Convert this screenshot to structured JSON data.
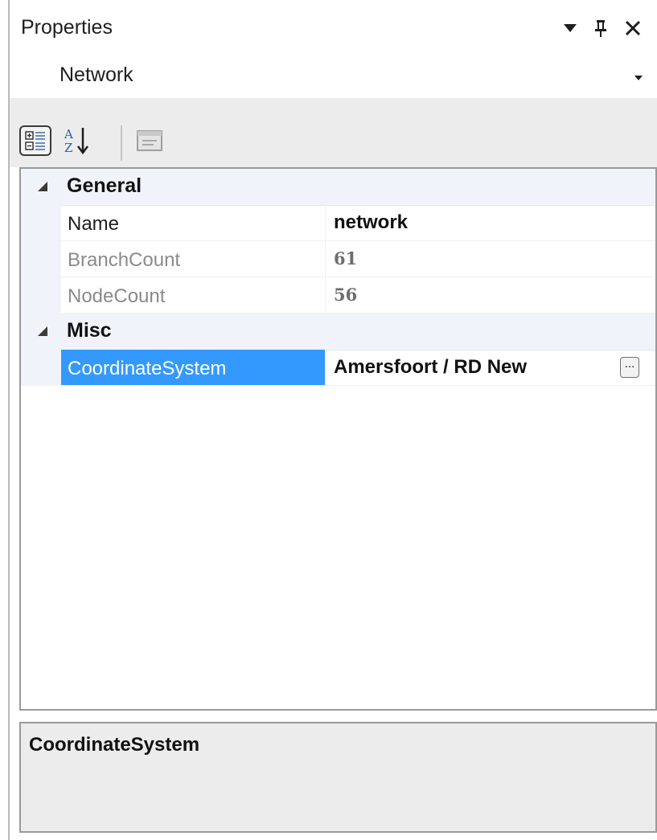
{
  "panel": {
    "title": "Properties"
  },
  "selector": {
    "value": "Network"
  },
  "toolbar": {
    "categorized": "categorized-icon",
    "alphabetical": "sort-az-icon",
    "property_pages": "property-pages-icon"
  },
  "grid": {
    "categories": [
      {
        "label": "General",
        "properties": [
          {
            "name": "Name",
            "value": "network",
            "readonly": false
          },
          {
            "name": "BranchCount",
            "value": "61",
            "readonly": true
          },
          {
            "name": "NodeCount",
            "value": "56",
            "readonly": true
          }
        ]
      },
      {
        "label": "Misc",
        "properties": [
          {
            "name": "CoordinateSystem",
            "value": "Amersfoort / RD New",
            "readonly": false,
            "selected": true,
            "ellipsis": "..."
          }
        ]
      }
    ]
  },
  "description": {
    "title": "CoordinateSystem"
  },
  "colors": {
    "selection": "#3399ff",
    "category_background": "#f0f4fa",
    "toolbar_background": "#ececec"
  }
}
